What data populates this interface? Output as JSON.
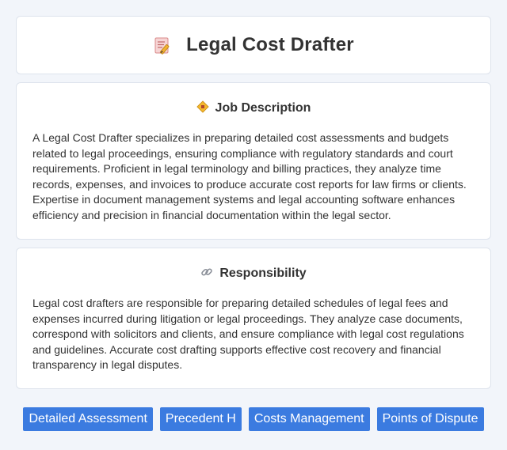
{
  "page": {
    "title": "Legal Cost Drafter",
    "title_icon": "memo-pencil-icon"
  },
  "job_description": {
    "heading": "Job Description",
    "icon": "diamond-badge-icon",
    "body": "A Legal Cost Drafter specializes in preparing detailed cost assessments and budgets related to legal proceedings, ensuring compliance with regulatory standards and court requirements. Proficient in legal terminology and billing practices, they analyze time records, expenses, and invoices to produce accurate cost reports for law firms or clients. Expertise in document management systems and legal accounting software enhances efficiency and precision in financial documentation within the legal sector."
  },
  "responsibility": {
    "heading": "Responsibility",
    "icon": "link-icon",
    "body": "Legal cost drafters are responsible for preparing detailed schedules of legal fees and expenses incurred during litigation or legal proceedings. They analyze case documents, correspond with solicitors and clients, and ensure compliance with legal cost regulations and guidelines. Accurate cost drafting supports effective cost recovery and financial transparency in legal disputes."
  },
  "tags": [
    "Detailed Assessment",
    "Precedent H",
    "Costs Management",
    "Points of Dispute"
  ],
  "colors": {
    "background": "#f2f5fa",
    "card": "#ffffff",
    "tag": "#3b7be0",
    "tag_text": "#ffffff"
  }
}
